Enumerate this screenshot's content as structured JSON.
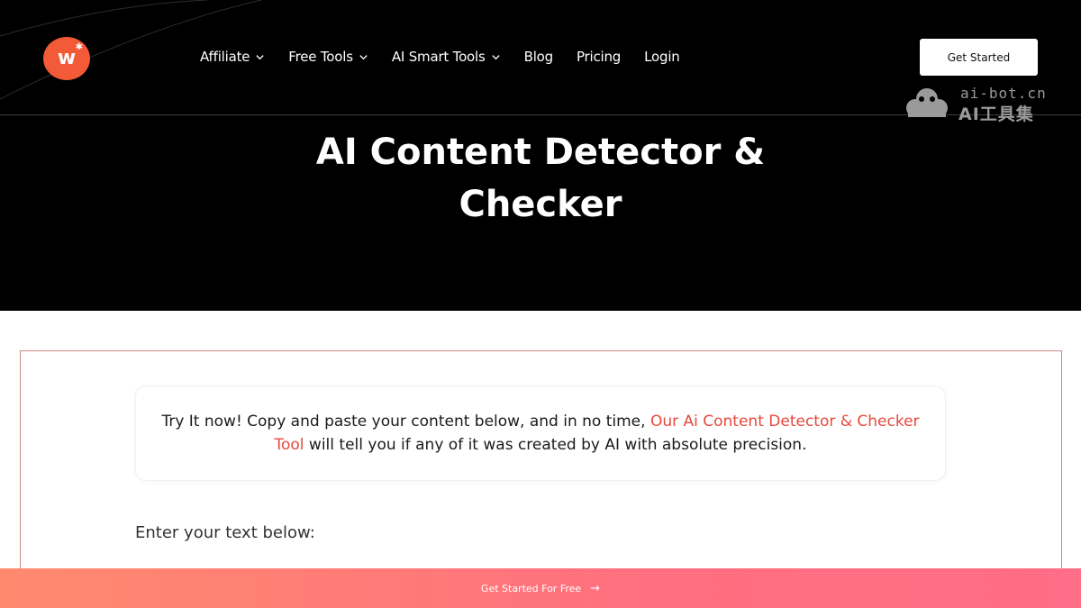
{
  "brand": {
    "logo_letter": "w",
    "logo_color": "#f25a38"
  },
  "nav": {
    "items": [
      {
        "label": "Affiliate",
        "dropdown": true
      },
      {
        "label": "Free Tools",
        "dropdown": true
      },
      {
        "label": "AI Smart Tools",
        "dropdown": true
      },
      {
        "label": "Blog",
        "dropdown": false
      },
      {
        "label": "Pricing",
        "dropdown": false
      },
      {
        "label": "Login",
        "dropdown": false
      }
    ],
    "cta_label": "Get Started"
  },
  "watermark": {
    "url": "ai-bot.cn",
    "name": "AI工具集"
  },
  "hero": {
    "title_line1": "AI Content Detector &",
    "title_line2": "Checker"
  },
  "tool": {
    "intro_before": "Try It now! Copy and paste your content below, and in no time, ",
    "intro_highlight": "Our Ai Content Detector & Checker Tool",
    "intro_after": " will tell you if any of it was created by AI with absolute precision.",
    "input_label": "Enter your text below:"
  },
  "cta_bar": {
    "label": "Get Started For Free",
    "arrow": "→"
  },
  "colors": {
    "accent": "#e8483c",
    "hero_bg": "#000000",
    "cta_start": "#ff8a6e",
    "cta_end": "#ff6d86"
  }
}
